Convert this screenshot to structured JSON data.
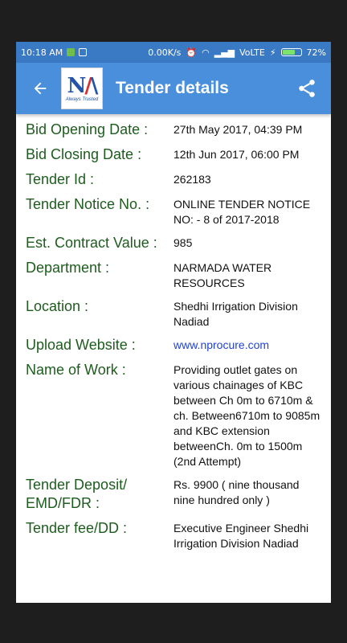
{
  "status_bar": {
    "time": "10:18 AM",
    "network_speed": "0.00K/s",
    "carrier": "VoLTE",
    "battery": "72%",
    "battery_level": 0.72
  },
  "app_bar": {
    "title": "Tender details",
    "logo_tagline": "Always Trusted"
  },
  "details": [
    {
      "label": "Bid Opening Date :",
      "value": "27th May 2017, 04:39 PM"
    },
    {
      "label": "Bid Closing Date :",
      "value": "12th Jun 2017, 06:00 PM"
    },
    {
      "label": "Tender Id :",
      "value": "262183"
    },
    {
      "label": "Tender Notice No. :",
      "value": "ONLINE TENDER NOTICE NO: - 8 of 2017-2018"
    },
    {
      "label": "Est. Contract Value :",
      "value": "985"
    },
    {
      "label": "Department :",
      "value": "NARMADA WATER RESOURCES"
    },
    {
      "label": "Location :",
      "value": "Shedhi Irrigation Division Nadiad"
    },
    {
      "label": "Upload Website :",
      "value": "www.nprocure.com"
    },
    {
      "label": "Name of Work :",
      "value": "Providing outlet gates on various chainages of KBC between Ch 0m to 6710m & ch. Between6710m to 9085m and KBC extension betweenCh. 0m to 1500m (2nd Attempt)"
    },
    {
      "label": "Tender Deposit/ EMD/FDR :",
      "value": "Rs. 9900 ( nine thousand nine hundred only )"
    },
    {
      "label": "Tender fee/DD :",
      "value": "Executive Engineer Shedhi Irrigation Division Nadiad"
    }
  ]
}
